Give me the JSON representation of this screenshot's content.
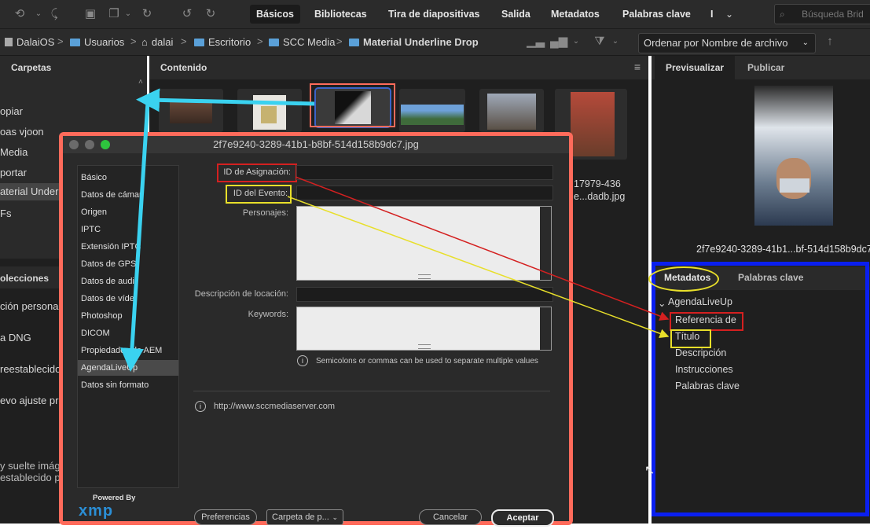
{
  "toolbar": {
    "tabs": [
      "Básicos",
      "Bibliotecas",
      "Tira de diapositivas",
      "Salida",
      "Metadatos",
      "Palabras clave"
    ],
    "overflow_label": "I",
    "search_placeholder": "Búsqueda Brid"
  },
  "path": {
    "app": "DalaiOS",
    "segments": [
      "Usuarios",
      "dalai",
      "Escritorio",
      "SCC Media",
      "Material Underline Drop"
    ],
    "sort_label": "Ordenar por Nombre de archivo"
  },
  "left_panel": {
    "tab": "Carpetas",
    "folders": [
      "opiar",
      "oas vjoon",
      "Media",
      "portar",
      "aterial Underlin",
      "Fs"
    ],
    "collections_header": "olecciones",
    "collections": [
      "ción personaliz",
      "a DNG",
      "reestablecido",
      "evo ajuste pre"
    ],
    "hint_line1": "y suelte imág",
    "hint_line2": "establecido p"
  },
  "content": {
    "tab": "Contenido",
    "file_label_1": "17979-436",
    "file_label_2": "e...dadb.jpg"
  },
  "dialog": {
    "title": "2f7e9240-3289-41b1-b8bf-514d158b9dc7.jpg",
    "nav": [
      "Básico",
      "Datos de cámar",
      "Origen",
      "IPTC",
      "Extensión IPTC",
      "Datos de GPS",
      "Datos de audi",
      "Datos de víde",
      "Photoshop",
      "DICOM",
      "Propiedades de AEM",
      "AgendaLiveUp",
      "Datos sin formato"
    ],
    "selected_nav": "AgendaLiveUp",
    "fields": {
      "assign_id": "ID de Asignación:",
      "event_id": "ID del Evento:",
      "people": "Personajes:",
      "location": "Descripción de locación:",
      "keywords": "Keywords:"
    },
    "hint": "Semicolons or commas can be used to separate multiple values",
    "url": "http://www.sccmediaserver.com",
    "powered_by": "Powered By",
    "xmp": "xmp",
    "buttons": {
      "prefs": "Preferencias",
      "folder": "Carpeta de p...",
      "cancel": "Cancelar",
      "ok": "Aceptar"
    }
  },
  "right_panel": {
    "tabs": [
      "Previsualizar",
      "Publicar"
    ],
    "filename": "2f7e9240-3289-41b1...bf-514d158b9dc7",
    "meta_tabs": [
      "Metadatos",
      "Palabras clave"
    ],
    "group": "AgendaLiveUp",
    "items": [
      "Referencia de",
      "Título",
      "Descripción",
      "Instrucciones",
      "Palabras clave"
    ]
  },
  "colors": {
    "annotation_red": "#d42020",
    "annotation_yellow": "#e8df2a",
    "annotation_cyan": "#3ad2f0",
    "annotation_blue": "#0a1ff0",
    "dialog_border": "#ff6b5b"
  }
}
